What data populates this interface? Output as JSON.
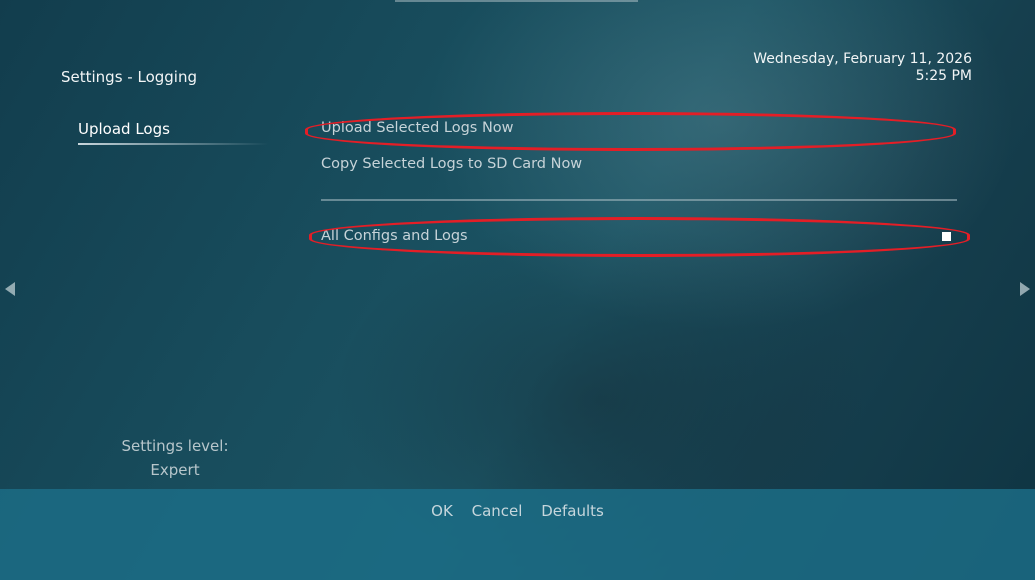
{
  "header": {
    "title": "Settings - Logging",
    "date": "Wednesday, February 11, 2026",
    "time": "5:25 PM"
  },
  "sidebar": {
    "items": [
      {
        "label": "Upload Logs"
      }
    ],
    "settings_level_label": "Settings level:",
    "settings_level_value": "Expert"
  },
  "main": {
    "settings": [
      {
        "label": "Upload Selected Logs Now"
      },
      {
        "label": "Copy Selected Logs to SD Card Now"
      },
      {
        "label": "All Configs and Logs",
        "enabled": true
      }
    ]
  },
  "footer": {
    "ok_label": "OK",
    "cancel_label": "Cancel",
    "defaults_label": "Defaults"
  },
  "icons": {
    "left": "arrow-left-icon",
    "right": "arrow-right-icon"
  },
  "colors": {
    "highlight": "#e41e26",
    "footer": "#1c6e87"
  }
}
